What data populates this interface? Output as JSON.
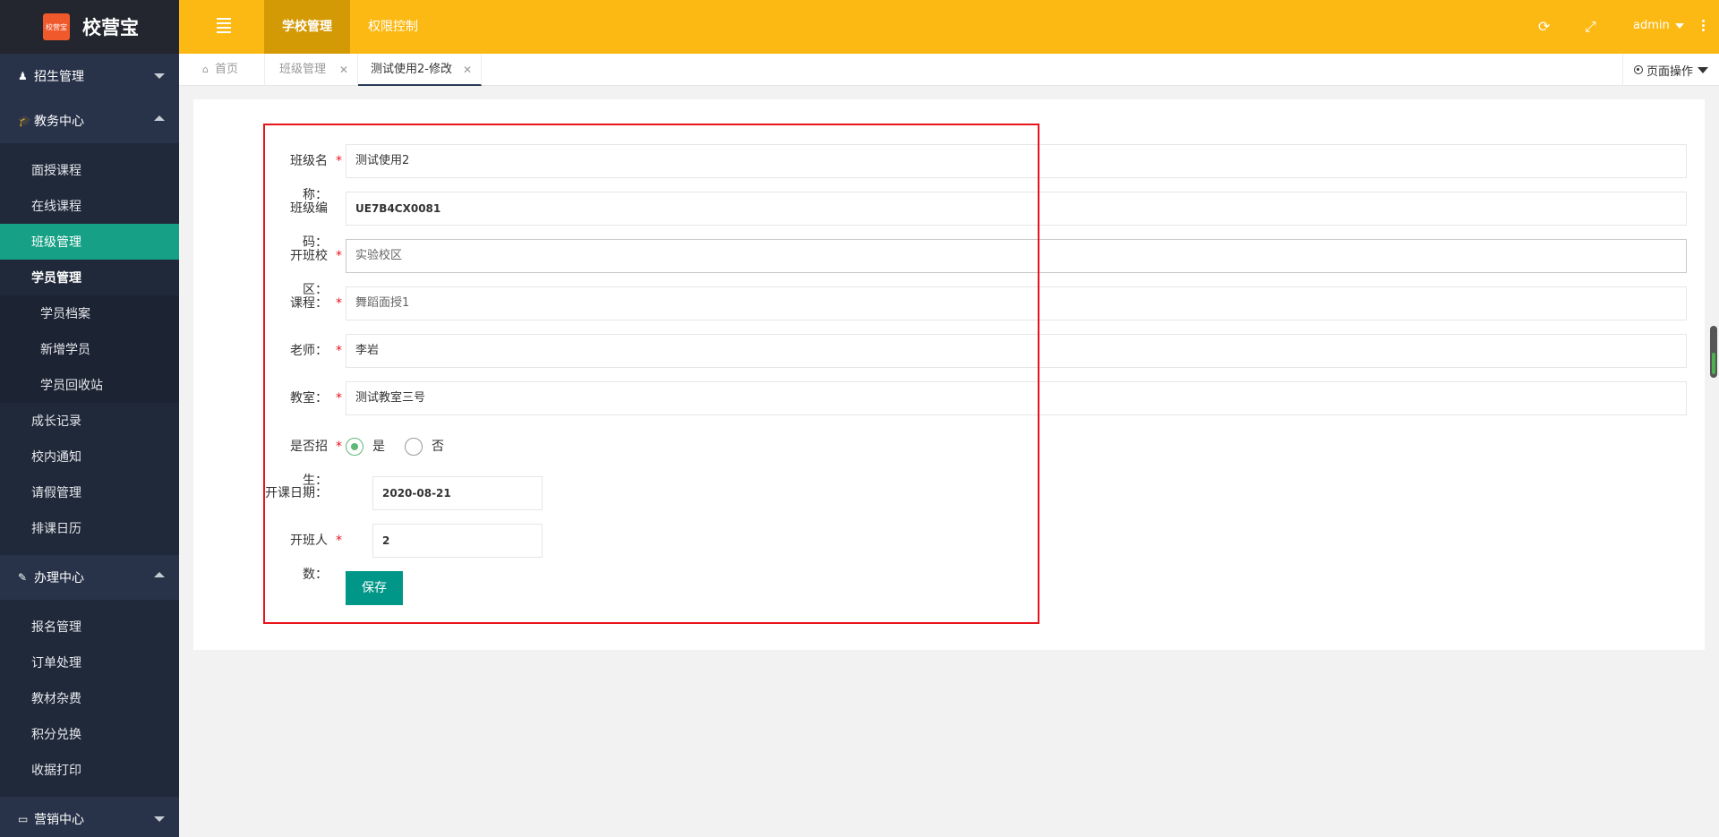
{
  "app": {
    "logo_badge": "校营宝",
    "title": "校营宝"
  },
  "sidebar": {
    "groups": [
      {
        "label": "招生管理",
        "icon": "user-icon",
        "expanded": false
      },
      {
        "label": "教务中心",
        "icon": "graduation-cap-icon",
        "expanded": true
      },
      {
        "label": "办理中心",
        "icon": "edit-icon",
        "expanded": true
      },
      {
        "label": "营销中心",
        "icon": "laptop-icon",
        "expanded": false
      }
    ],
    "teaching": [
      "面授课程",
      "在线课程",
      "班级管理",
      "学员管理"
    ],
    "student_sub": [
      "学员档案",
      "新增学员",
      "学员回收站"
    ],
    "teaching_more": [
      "成长记录",
      "校内通知",
      "请假管理",
      "排课日历"
    ],
    "handling": [
      "报名管理",
      "订单处理",
      "教材杂费",
      "积分兑换",
      "收据打印"
    ]
  },
  "header": {
    "tabs": [
      "学校管理",
      "权限控制"
    ],
    "user": "admin"
  },
  "tabbar": {
    "tabs": [
      {
        "label": "首页"
      },
      {
        "label": "班级管理"
      },
      {
        "label": "测试使用2-修改"
      }
    ],
    "page_ops": "页面操作"
  },
  "form": {
    "fields": [
      {
        "label": "班级名称：",
        "value": "测试使用2",
        "required": true
      },
      {
        "label": "班级编码：",
        "value": "UE7B4CX0081",
        "required": false
      },
      {
        "label": "开班校区：",
        "value": "实验校区",
        "required": true
      },
      {
        "label": "课程：",
        "value": "舞蹈面授1",
        "required": true
      },
      {
        "label": "老师：",
        "value": "李岩",
        "required": true
      },
      {
        "label": "教室：",
        "value": "测试教室三号",
        "required": true
      }
    ],
    "recruit": {
      "label": "是否招生：",
      "yes": "是",
      "no": "否",
      "selected": "是"
    },
    "start_date": {
      "label": "开课日期：",
      "value": "2020-08-21"
    },
    "capacity": {
      "label": "开班人数：",
      "value": "2"
    },
    "save": "保存"
  },
  "colors": {
    "header": "#fdb913",
    "sidebar": "#20293a",
    "active": "#16a085",
    "save": "#009688",
    "highlight": "#e8141b"
  }
}
